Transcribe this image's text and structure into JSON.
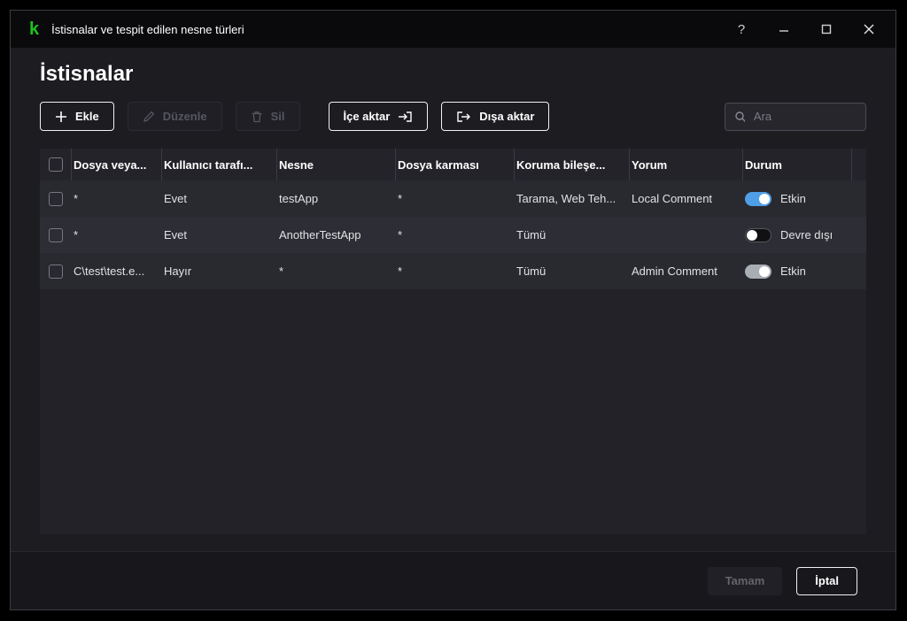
{
  "window": {
    "title": "İstisnalar ve tespit edilen nesne türleri",
    "help": "?",
    "minimize": "–",
    "close": "✕"
  },
  "page": {
    "title": "İstisnalar"
  },
  "toolbar": {
    "add": "Ekle",
    "edit": "Düzenle",
    "delete": "Sil",
    "import": "İçe aktar",
    "export": "Dışa aktar"
  },
  "search": {
    "placeholder": "Ara"
  },
  "table": {
    "columns": [
      "Dosya veya...",
      "Kullanıcı tarafı...",
      "Nesne",
      "Dosya karması",
      "Koruma bileşe...",
      "Yorum",
      "Durum"
    ],
    "rows": [
      {
        "file": "*",
        "user": "Evet",
        "object": "testApp",
        "hash": "*",
        "components": "Tarama, Web Teh...",
        "comment": "Local Comment",
        "status": "Etkin",
        "toggle": "on-blue"
      },
      {
        "file": "*",
        "user": "Evet",
        "object": "AnotherTestApp",
        "hash": "*",
        "components": "Tümü",
        "comment": "",
        "status": "Devre dışı",
        "toggle": "off"
      },
      {
        "file": "C\\test\\test.e...",
        "user": "Hayır",
        "object": "*",
        "hash": "*",
        "components": "Tümü",
        "comment": "Admin Comment",
        "status": "Etkin",
        "toggle": "on-gray"
      }
    ]
  },
  "footer": {
    "ok": "Tamam",
    "cancel": "İptal"
  },
  "colors": {
    "logo_green": "#1ec11e",
    "toggle_on_blue": "#4f9fe8",
    "toggle_on_gray": "#a9adb4",
    "window_bg": "#1c1c21"
  }
}
